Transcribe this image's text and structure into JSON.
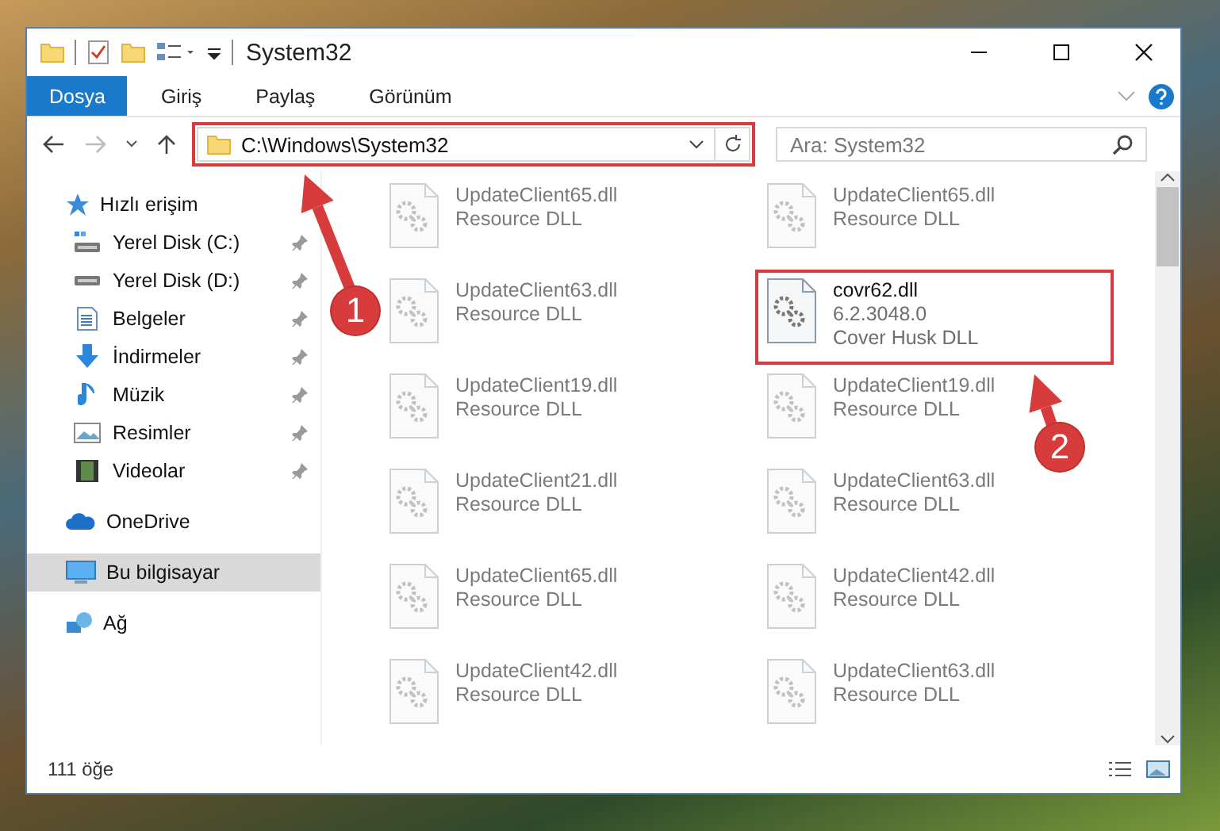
{
  "window": {
    "title": "System32"
  },
  "ribbon_tabs": [
    {
      "label": "Dosya",
      "selected": true
    },
    {
      "label": "Giriş",
      "selected": false
    },
    {
      "label": "Paylaş",
      "selected": false
    },
    {
      "label": "Görünüm",
      "selected": false
    }
  ],
  "address_bar": {
    "path": "C:\\Windows\\System32",
    "highlighted": true
  },
  "search": {
    "placeholder": "Ara: System32"
  },
  "sidebar": {
    "items": [
      {
        "label": "Hızlı erişim",
        "selected": false,
        "children": [
          {
            "label": "Yerel Disk (C:)",
            "pinned": true,
            "selected": false
          },
          {
            "label": "Yerel Disk (D:)",
            "pinned": true,
            "selected": false
          },
          {
            "label": "Belgeler",
            "pinned": true,
            "selected": false
          },
          {
            "label": "İndirmeler",
            "pinned": true,
            "selected": false
          },
          {
            "label": "Müzik",
            "pinned": true,
            "selected": false
          },
          {
            "label": "Resimler",
            "pinned": true,
            "selected": false
          },
          {
            "label": "Videolar",
            "pinned": true,
            "selected": false
          }
        ]
      },
      {
        "label": "OneDrive",
        "selected": false
      },
      {
        "label": "Bu bilgisayar",
        "selected": true
      },
      {
        "label": "Ağ",
        "selected": false
      }
    ]
  },
  "files": [
    {
      "name": "UpdateClient65.dll",
      "details": [
        "Resource DLL"
      ],
      "blurred": true,
      "highlighted": false
    },
    {
      "name": "UpdateClient65.dll",
      "details": [
        "Resource DLL"
      ],
      "blurred": true,
      "highlighted": false
    },
    {
      "name": "UpdateClient63.dll",
      "details": [
        "Resource DLL"
      ],
      "blurred": true,
      "highlighted": false
    },
    {
      "name": "covr62.dll",
      "details": [
        "6.2.3048.0",
        "Cover Husk DLL"
      ],
      "blurred": false,
      "highlighted": true
    },
    {
      "name": "UpdateClient19.dll",
      "details": [
        "Resource DLL"
      ],
      "blurred": true,
      "highlighted": false
    },
    {
      "name": "UpdateClient19.dll",
      "details": [
        "Resource DLL"
      ],
      "blurred": true,
      "highlighted": false
    },
    {
      "name": "UpdateClient21.dll",
      "details": [
        "Resource DLL"
      ],
      "blurred": true,
      "highlighted": false
    },
    {
      "name": "UpdateClient63.dll",
      "details": [
        "Resource DLL"
      ],
      "blurred": true,
      "highlighted": false
    },
    {
      "name": "UpdateClient65.dll",
      "details": [
        "Resource DLL"
      ],
      "blurred": true,
      "highlighted": false
    },
    {
      "name": "UpdateClient42.dll",
      "details": [
        "Resource DLL"
      ],
      "blurred": true,
      "highlighted": false
    },
    {
      "name": "UpdateClient42.dll",
      "details": [
        "Resource DLL"
      ],
      "blurred": true,
      "highlighted": false
    },
    {
      "name": "UpdateClient63.dll",
      "details": [
        "Resource DLL"
      ],
      "blurred": true,
      "highlighted": false
    }
  ],
  "status_bar": {
    "item_count": "111 öğe"
  },
  "annotations": [
    {
      "number": "1"
    },
    {
      "number": "2"
    }
  ]
}
